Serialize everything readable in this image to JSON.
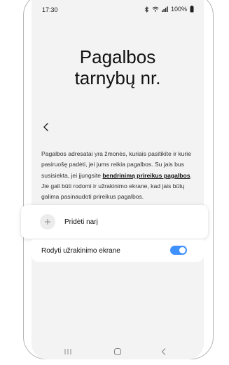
{
  "status_bar": {
    "time": "17:30",
    "battery": "100%",
    "icons": [
      "bluetooth-icon",
      "wifi-icon",
      "signal-icon",
      "battery-icon"
    ]
  },
  "page": {
    "title_line1": "Pagalbos",
    "title_line2": "tarnybų nr.",
    "description_part1": "Pagalbos adresatai yra žmonės, kuriais pasitikite ir kurie pasiruošę padėti, jei jums reikia pagalbos. Su jais bus susisiekta, jei įjungsite ",
    "description_link": "bendrinimą prireikus pagalbos",
    "description_part2": ". Jie gali būti rodomi ir užrakinimo ekrane, kad jais būtų galima pasinaudoti prireikus pagalbos."
  },
  "add_member": {
    "label": "Pridėti narį",
    "icon": "plus-icon"
  },
  "lock_screen_toggle": {
    "label": "Rodyti užrakinimo ekrane",
    "checked": true
  },
  "navigation": {
    "icons": [
      "recent-apps-icon",
      "home-icon",
      "back-icon"
    ]
  },
  "colors": {
    "accent": "#3e91ff",
    "screen_background": "#f3f3f3",
    "card_background": "#ffffff"
  }
}
